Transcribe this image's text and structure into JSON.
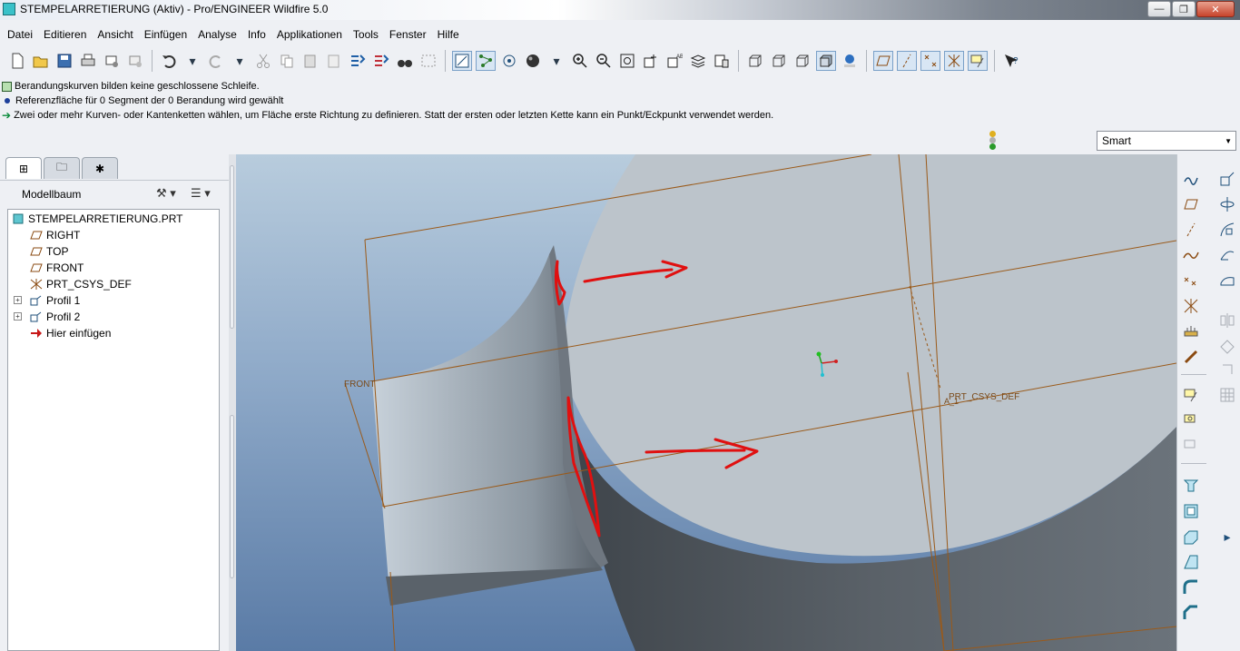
{
  "window": {
    "title": "STEMPELARRETIERUNG (Aktiv) - Pro/ENGINEER Wildfire 5.0",
    "controls": {
      "minimize": "—",
      "maximize": "❐",
      "close": "✕"
    }
  },
  "menu": [
    "Datei",
    "Editieren",
    "Ansicht",
    "Einfügen",
    "Analyse",
    "Info",
    "Applikationen",
    "Tools",
    "Fenster",
    "Hilfe"
  ],
  "messages": [
    "Berandungskurven bilden keine geschlossene Schleife.",
    "Referenzfläche für 0 Segment der 0 Berandung wird gewählt",
    "Zwei oder mehr Kurven- oder Kantenketten wählen, um Fläche erste Richtung zu definieren. Statt der ersten oder letzten Kette kann ein Punkt/Eckpunkt verwendet werden."
  ],
  "filter": {
    "selected": "Smart"
  },
  "model_tree": {
    "header": "Modellbaum",
    "root": "STEMPELARRETIERUNG.PRT",
    "items": [
      "RIGHT",
      "TOP",
      "FRONT",
      "PRT_CSYS_DEF",
      "Profil 1",
      "Profil 2",
      "Hier einfügen"
    ]
  },
  "viewport": {
    "labels": {
      "front": "FRONT",
      "csys": "PRT_CSYS_DEF",
      "axis": "A_1"
    },
    "colors": {
      "annotation": "#e01010",
      "datum": "#9a5a1a"
    }
  }
}
